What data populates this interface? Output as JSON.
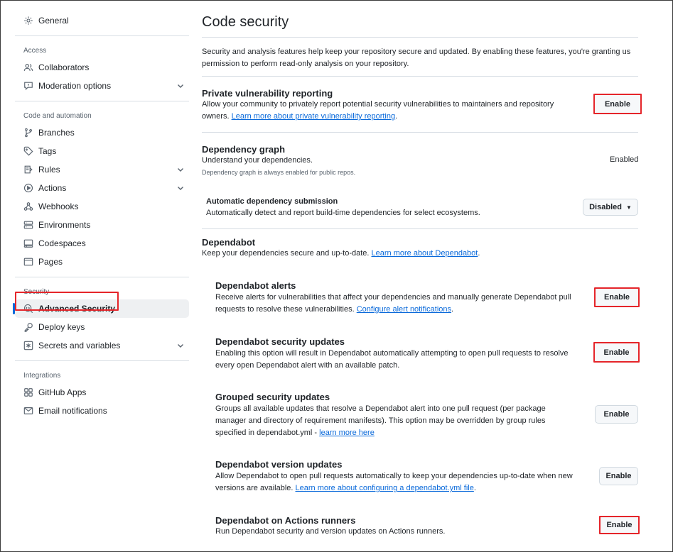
{
  "sidebar": {
    "general": "General",
    "sections": [
      {
        "heading": "Access",
        "items": [
          "Collaborators",
          "Moderation options"
        ]
      },
      {
        "heading": "Code and automation",
        "items": [
          "Branches",
          "Tags",
          "Rules",
          "Actions",
          "Webhooks",
          "Environments",
          "Codespaces",
          "Pages"
        ]
      },
      {
        "heading": "Security",
        "items": [
          "Advanced Security",
          "Deploy keys",
          "Secrets and variables"
        ]
      },
      {
        "heading": "Integrations",
        "items": [
          "GitHub Apps",
          "Email notifications"
        ]
      }
    ],
    "active_item": "Advanced Security"
  },
  "main": {
    "title": "Code security",
    "intro": "Security and analysis features help keep your repository secure and updated. By enabling these features, you're granting us permission to perform read-only analysis on your repository.",
    "pvr": {
      "title": "Private vulnerability reporting",
      "desc": "Allow your community to privately report potential security vulnerabilities to maintainers and repository owners.",
      "link": "Learn more about private vulnerability reporting",
      "button": "Enable"
    },
    "depgraph": {
      "title": "Dependency graph",
      "desc": "Understand your dependencies.",
      "note": "Dependency graph is always enabled for public repos.",
      "status": "Enabled"
    },
    "autosub": {
      "title": "Automatic dependency submission",
      "desc": "Automatically detect and report build-time dependencies for select ecosystems.",
      "dropdown": "Disabled"
    },
    "dependabot": {
      "title": "Dependabot",
      "desc": "Keep your dependencies secure and up-to-date.",
      "link": "Learn more about Dependabot"
    },
    "alerts": {
      "title": "Dependabot alerts",
      "desc": "Receive alerts for vulnerabilities that affect your dependencies and manually generate Dependabot pull requests to resolve these vulnerabilities.",
      "link": "Configure alert notifications",
      "button": "Enable"
    },
    "secupdates": {
      "title": "Dependabot security updates",
      "desc": "Enabling this option will result in Dependabot automatically attempting to open pull requests to resolve every open Dependabot alert with an available patch.",
      "button": "Enable"
    },
    "grouped": {
      "title": "Grouped security updates",
      "desc": "Groups all available updates that resolve a Dependabot alert into one pull request (per package manager and directory of requirement manifests). This option may be overridden by group rules specified in dependabot.yml -",
      "link": "learn more here",
      "button": "Enable"
    },
    "version": {
      "title": "Dependabot version updates",
      "desc": "Allow Dependabot to open pull requests automatically to keep your dependencies up-to-date when new versions are available.",
      "link": "Learn more about configuring a dependabot.yml file",
      "button": "Enable"
    },
    "runners": {
      "title": "Dependabot on Actions runners",
      "desc": "Run Dependabot security and version updates on Actions runners.",
      "button": "Enable"
    }
  },
  "colors": {
    "highlight": "#e5252a",
    "link": "#0969da",
    "active_bg": "#eef0f2"
  }
}
